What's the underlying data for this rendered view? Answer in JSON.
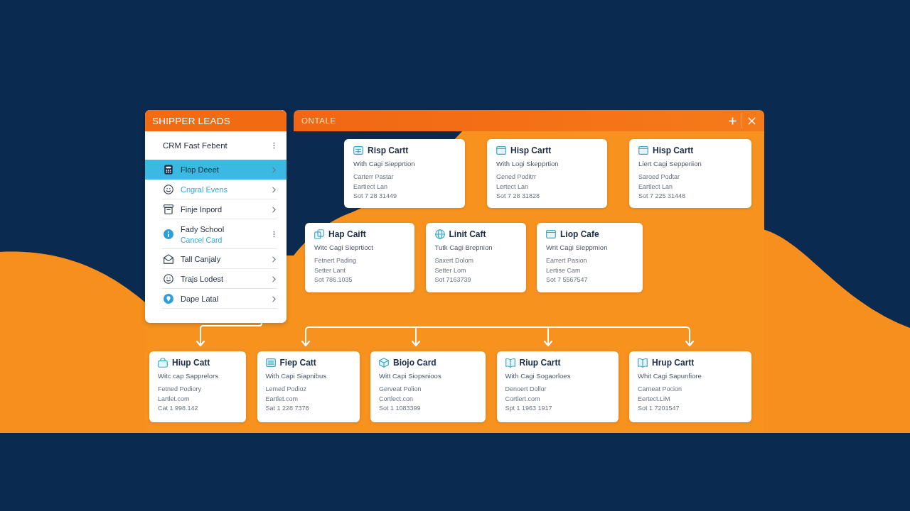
{
  "sidebar": {
    "title": "SHIPPER LEADS",
    "items": [
      {
        "label": "CRM Fast Febent",
        "kind": "menu",
        "selected": false
      },
      {
        "label": "Flop Deeet",
        "kind": "nav",
        "selected": true
      },
      {
        "label": "Cngral Evens",
        "kind": "link",
        "selected": false
      },
      {
        "label": "Finje Inpord",
        "kind": "nav",
        "selected": false
      },
      {
        "label": "Fady School",
        "sublabel": "Cancel Card",
        "kind": "menu",
        "selected": false
      },
      {
        "label": "Tall Canjaly",
        "kind": "nav",
        "selected": false
      },
      {
        "label": "Trajs Lodest",
        "kind": "nav",
        "selected": false
      },
      {
        "label": "Dape Latal",
        "kind": "nav",
        "selected": false
      }
    ]
  },
  "window": {
    "title": "ONTALE",
    "card_rows": [
      {
        "cards": [
          {
            "title": "Risp Cartt",
            "subtitle": "With Cagi Siepprtion",
            "lines": [
              "Carterr Pastar",
              "Eartiect Lan",
              "Sot 7 28 31449"
            ]
          },
          {
            "title": "Hisp Cartt",
            "subtitle": "With Logi Skepprtion",
            "lines": [
              "Gened Poditrr",
              "Lertect Lan",
              "Sot 7 28 31828"
            ]
          },
          {
            "title": "Hisp Cartt",
            "subtitle": "Liert Cagi Sepperiion",
            "lines": [
              "Saroed Podtar",
              "Eartlect Lan",
              "Sot 7 225 31448"
            ]
          }
        ]
      },
      {
        "cards": [
          {
            "title": "Hap Caift",
            "subtitle": "Witc Cagi Sieprtioct",
            "lines": [
              "Fetnert Pading",
              "Setter Lant",
              "Sot 786.1035"
            ]
          },
          {
            "title": "Linit Caft",
            "subtitle": "Tutk Cagi Brepnion",
            "lines": [
              "Saxert Dolom",
              "Setter Lom",
              "Sot 7163739"
            ]
          },
          {
            "title": "Liop Cafe",
            "subtitle": "Writ Cagi Sieppmion",
            "lines": [
              "Earrert Pasion",
              "Lertise Cam",
              "Sot 7 5567547"
            ]
          }
        ]
      }
    ]
  },
  "flow_cards": [
    {
      "title": "Hiup Catt",
      "subtitle": "Witc cap Sapprelors",
      "lines": [
        "Fetned Podiory",
        "Lartlet.com",
        "Cat 1 998.142"
      ]
    },
    {
      "title": "Fiep Catt",
      "subtitle": "With Capi Siapnibus",
      "lines": [
        "Lemed Podioz",
        "Eartlet.com",
        "Sat 1 228 7378"
      ]
    },
    {
      "title": "Biojo Card",
      "subtitle": "Witt Capi Siopsnioos",
      "lines": [
        "Gerveat Polion",
        "Cortlect.con",
        "Sot 1 1083399"
      ]
    },
    {
      "title": "Riup Cartt",
      "subtitle": "With Cagi Sogaorloes",
      "lines": [
        "Denoert Dollor",
        "Cortlert.com",
        "Spt 1 1963 1917"
      ]
    },
    {
      "title": "Hrup Cartt",
      "subtitle": "Whit Cagi Sapunfiore",
      "lines": [
        "Carneat Pocion",
        "Eertect.LiM",
        "Sot 1 7201547"
      ]
    }
  ]
}
